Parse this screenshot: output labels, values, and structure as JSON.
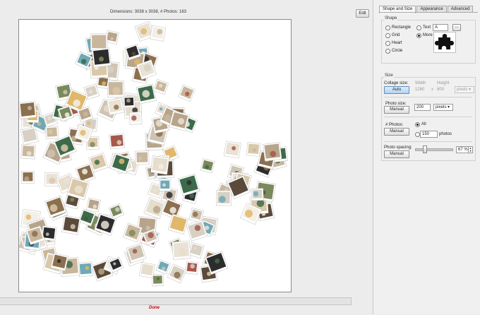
{
  "canvas": {
    "dimensions_label": "Dimensions: 3038 x 3038, # Photos: 163",
    "edit_label": "Edit",
    "status_text": "Done"
  },
  "tabs": [
    {
      "label": "Shape and Size",
      "active": true
    },
    {
      "label": "Appearance",
      "active": false
    },
    {
      "label": "Advanced",
      "active": false
    }
  ],
  "shape": {
    "group_label": "Shape",
    "options": {
      "rectangle": "Rectangle",
      "grid": "Grid",
      "heart": "Heart",
      "circle": "Circle",
      "text": "Text",
      "more": "More"
    },
    "selected": "More",
    "text_value": "A",
    "browse_label": "...",
    "preview_icon": "puzzle-piece-icon"
  },
  "size": {
    "group_label": "Size",
    "collage_size_label": "Collage size:",
    "collage_size_button": "Auto",
    "width_label": "Width",
    "height_label": "Height",
    "width_value": "1280",
    "times_label": "x",
    "height_value": "800",
    "unit_value": "pixels",
    "photo_size_label": "Photo size:",
    "photo_size_button": "Manual",
    "photo_size_value": "200",
    "photo_unit_value": "pixels",
    "photos_label": "# Photos:",
    "photos_button": "Manual",
    "all_label": "All",
    "photos_count_value": "150",
    "photos_suffix": "photos",
    "spacing_label": "Photo spacing:",
    "spacing_button": "Manual",
    "spacing_value": "67 %",
    "spacing_level": 0.0
  },
  "colors": {
    "accent": "#5e8fbf",
    "status_red": "#cc0000"
  }
}
